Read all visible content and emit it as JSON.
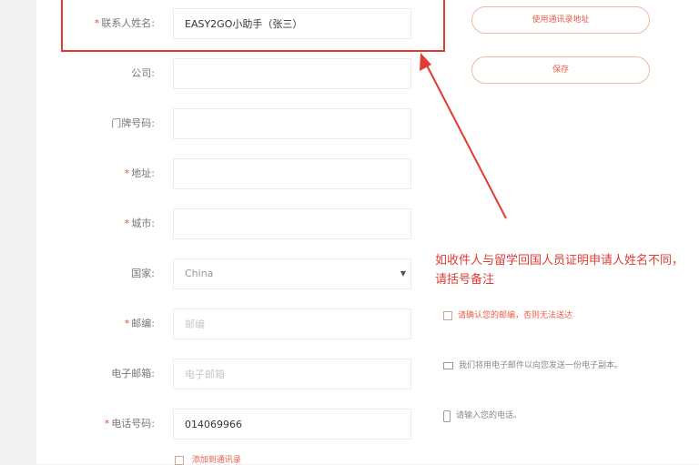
{
  "form": {
    "contact_name": {
      "label": "联系人姓名:",
      "required": true,
      "value": "EASY2GO小助手（张三）"
    },
    "company": {
      "label": "公司:",
      "required": false,
      "value": ""
    },
    "house_number": {
      "label": "门牌号码:",
      "required": false,
      "value": ""
    },
    "address": {
      "label": "地址:",
      "required": true,
      "value": ""
    },
    "city": {
      "label": "城市:",
      "required": true,
      "value": ""
    },
    "country": {
      "label": "国家:",
      "required": false,
      "value": "China"
    },
    "postcode": {
      "label": "邮编:",
      "required": true,
      "placeholder": "邮编"
    },
    "email": {
      "label": "电子邮箱:",
      "required": false,
      "placeholder": "电子邮箱"
    },
    "phone": {
      "label": "电话号码:",
      "required": true,
      "value": "014069966"
    },
    "required_mark": "*"
  },
  "buttons": {
    "top": "使用通讯录地址",
    "save": "保存"
  },
  "annotation": "如收件人与留学回国人员证明申请人姓名不同，请括号备注",
  "notes": {
    "postcode": "请确认您的邮编，否则无法送达",
    "email": "我们将用电子邮件以向您发送一份电子副本。",
    "phone": "请输入您的电话。"
  },
  "bottom_checkbox": "添加到通讯录",
  "colors": {
    "accent": "#e33b33",
    "button_text": "#e8604a"
  }
}
